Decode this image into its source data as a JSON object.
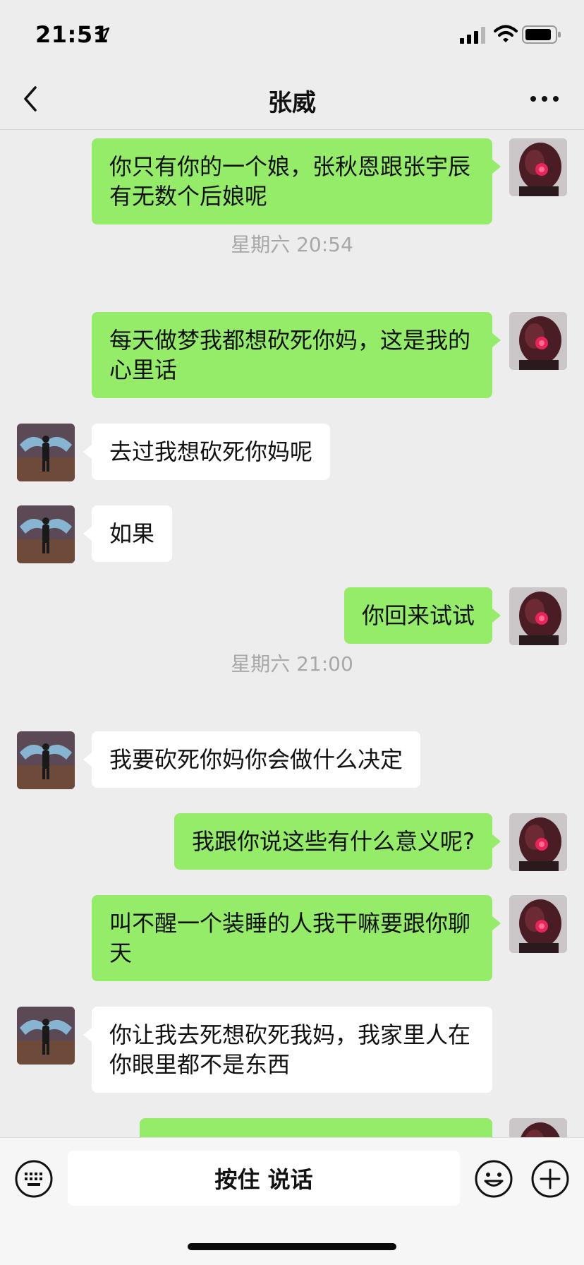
{
  "status_bar": {
    "time": "21:51"
  },
  "header": {
    "title": "张威"
  },
  "messages": [
    {
      "sender": "me",
      "text": "你只有你的一个娘，张秋恩跟张宇辰有无数个后娘呢"
    },
    {
      "type": "timestamp",
      "text": "星期六 20:54"
    },
    {
      "sender": "me",
      "text": "每天做梦我都想砍死你妈，这是我的心里话"
    },
    {
      "sender": "other",
      "text": "去过我想砍死你妈呢"
    },
    {
      "sender": "other",
      "text": "如果"
    },
    {
      "sender": "me",
      "text": "你回来试试"
    },
    {
      "type": "timestamp",
      "text": "星期六 21:00"
    },
    {
      "sender": "other",
      "text": "我要砍死你妈你会做什么决定"
    },
    {
      "sender": "me",
      "text": "我跟你说这些有什么意义呢?"
    },
    {
      "sender": "me",
      "text": "叫不醒一个装睡的人我干嘛要跟你聊天"
    },
    {
      "sender": "other",
      "text": "你让我去死想砍死我妈，我家里人在你眼里都不是东西"
    }
  ],
  "input_bar": {
    "voice_label": "按住 说话"
  },
  "colors": {
    "my_bubble": "#95ec69",
    "other_bubble": "#ffffff",
    "background": "#ededed"
  }
}
